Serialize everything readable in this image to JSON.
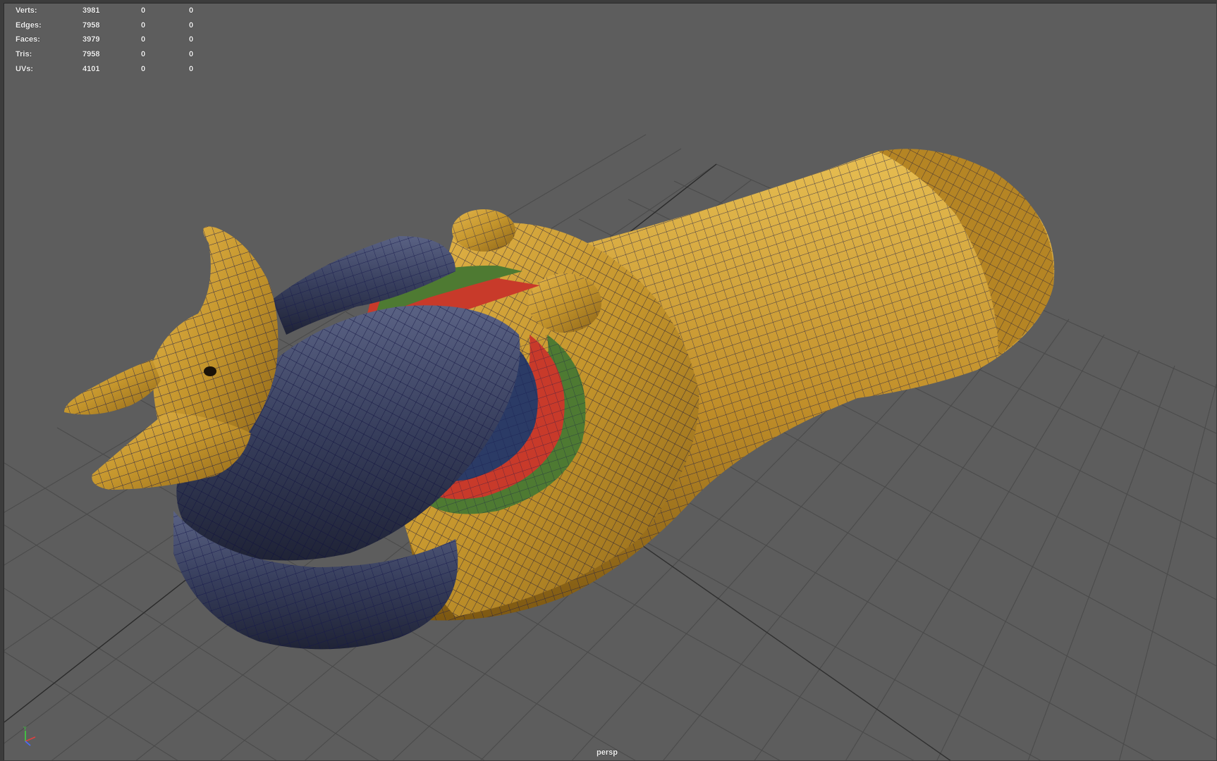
{
  "viewport": {
    "camera": "persp",
    "shading": "textured-wireframe-on-shaded",
    "background_color": "#5d5d5d",
    "grid_color": "#4a4a4a",
    "wire_color": "#12124a"
  },
  "hud": {
    "rows": [
      {
        "label": "Verts:",
        "total": "3981",
        "selected": "0",
        "component": "0"
      },
      {
        "label": "Edges:",
        "total": "7958",
        "selected": "0",
        "component": "0"
      },
      {
        "label": "Faces:",
        "total": "3979",
        "selected": "0",
        "component": "0"
      },
      {
        "label": "Tris:",
        "total": "7958",
        "selected": "0",
        "component": "0"
      },
      {
        "label": "UVs:",
        "total": "4101",
        "selected": "0",
        "component": "0"
      }
    ]
  },
  "axis_gizmo": {
    "icon": "xyz-axis-icon",
    "x_label": "",
    "y_label": "Y",
    "z_label": ""
  },
  "model": {
    "name": "",
    "gold_color": "#c99a2e",
    "headdress_color": "#3a4160",
    "collar_colors": [
      "#c83a2a",
      "#4e7a32",
      "#2b3b66"
    ]
  }
}
